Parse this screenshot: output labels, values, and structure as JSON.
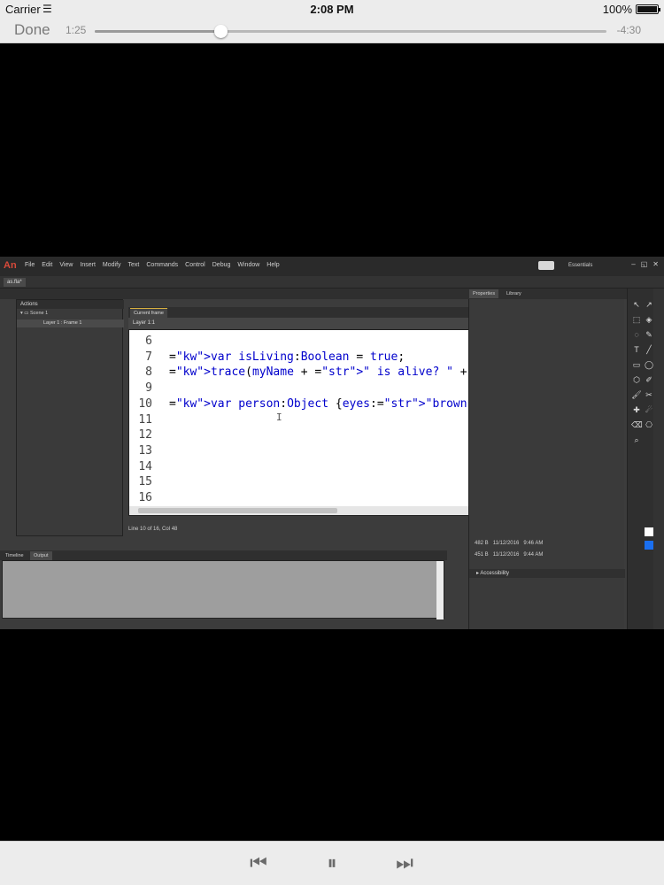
{
  "status_bar": {
    "carrier": "Carrier",
    "time": "2:08 PM",
    "battery": "100%"
  },
  "player": {
    "done_label": "Done",
    "elapsed": "1:25",
    "remaining": "-4:30",
    "progress": 0.245
  },
  "animate_ui": {
    "logo": "An",
    "menus": [
      "File",
      "Edit",
      "View",
      "Insert",
      "Modify",
      "Text",
      "Commands",
      "Control",
      "Debug",
      "Window",
      "Help"
    ],
    "workspace": "Essentials",
    "window_buttons": [
      "–",
      "◱",
      "✕"
    ],
    "doc_tab": "as.fla*",
    "panel_tabs": [
      "Properties",
      "Library"
    ],
    "actions_title": "Actions",
    "tree_scene": "Scene 1",
    "tree_layer": "Layer 1 : Frame 1",
    "editor_tab": "Current frame",
    "editor_path": "Layer 1:1",
    "editor_status": "Line 10 of 16, Col 48",
    "code_lines": [
      {
        "n": "6",
        "text": ""
      },
      {
        "n": "7",
        "text": "var isLiving:Boolean = true;"
      },
      {
        "n": "8",
        "text": "trace(myName + \" is alive? \" + isLiving);"
      },
      {
        "n": "9",
        "text": ""
      },
      {
        "n": "10",
        "text": "var person:Object {eyes:\"brown\", hair:\"brown\", };"
      },
      {
        "n": "11",
        "text": ""
      },
      {
        "n": "12",
        "text": ""
      },
      {
        "n": "13",
        "text": ""
      },
      {
        "n": "14",
        "text": ""
      },
      {
        "n": "15",
        "text": ""
      },
      {
        "n": "16",
        "text": ""
      }
    ],
    "library_rows": [
      {
        "size": "482 B",
        "date": "11/12/2016",
        "time": "9:46 AM"
      },
      {
        "size": "451 B",
        "date": "11/12/2016",
        "time": "9:44 AM"
      }
    ],
    "accessibility_label": "Accessibility",
    "bottom_tabs": [
      "Timeline",
      "Output"
    ]
  },
  "transport": {
    "prev": "⏮",
    "pause": "⏸",
    "next": "⏭"
  }
}
